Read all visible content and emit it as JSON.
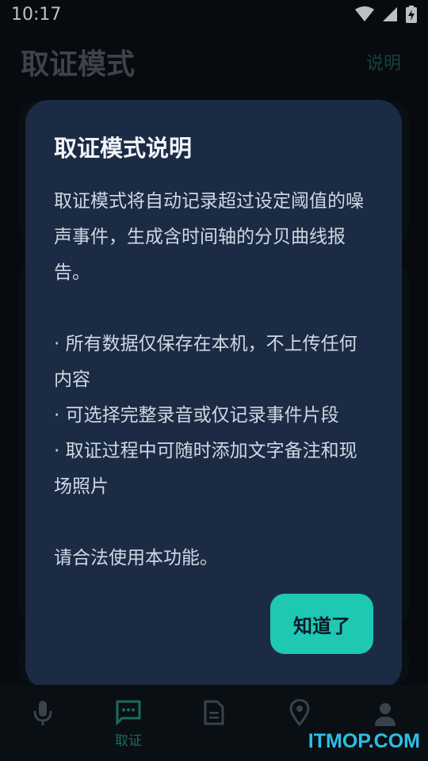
{
  "status": {
    "time": "10:17"
  },
  "appbar": {
    "title": "取证模式",
    "help_label": "说明"
  },
  "dialog": {
    "title": "取证模式说明",
    "paragraphs": [
      "取证模式将自动记录超过设定阈值的噪声事件，生成含时间轴的分贝曲线报告。",
      "· 所有数据仅保存在本机，不上传任何内容",
      "· 可选择完整录音或仅记录事件片段",
      "· 取证过程中可随时添加文字备注和现场照片",
      "请合法使用本功能。"
    ],
    "ok_label": "知道了"
  },
  "nav": {
    "active_label": "取证"
  },
  "watermark": "ITMOP.COM",
  "colors": {
    "accent": "#1ec8b2",
    "dialog_bg": "#1c2b44",
    "background": "#0a0f14"
  }
}
